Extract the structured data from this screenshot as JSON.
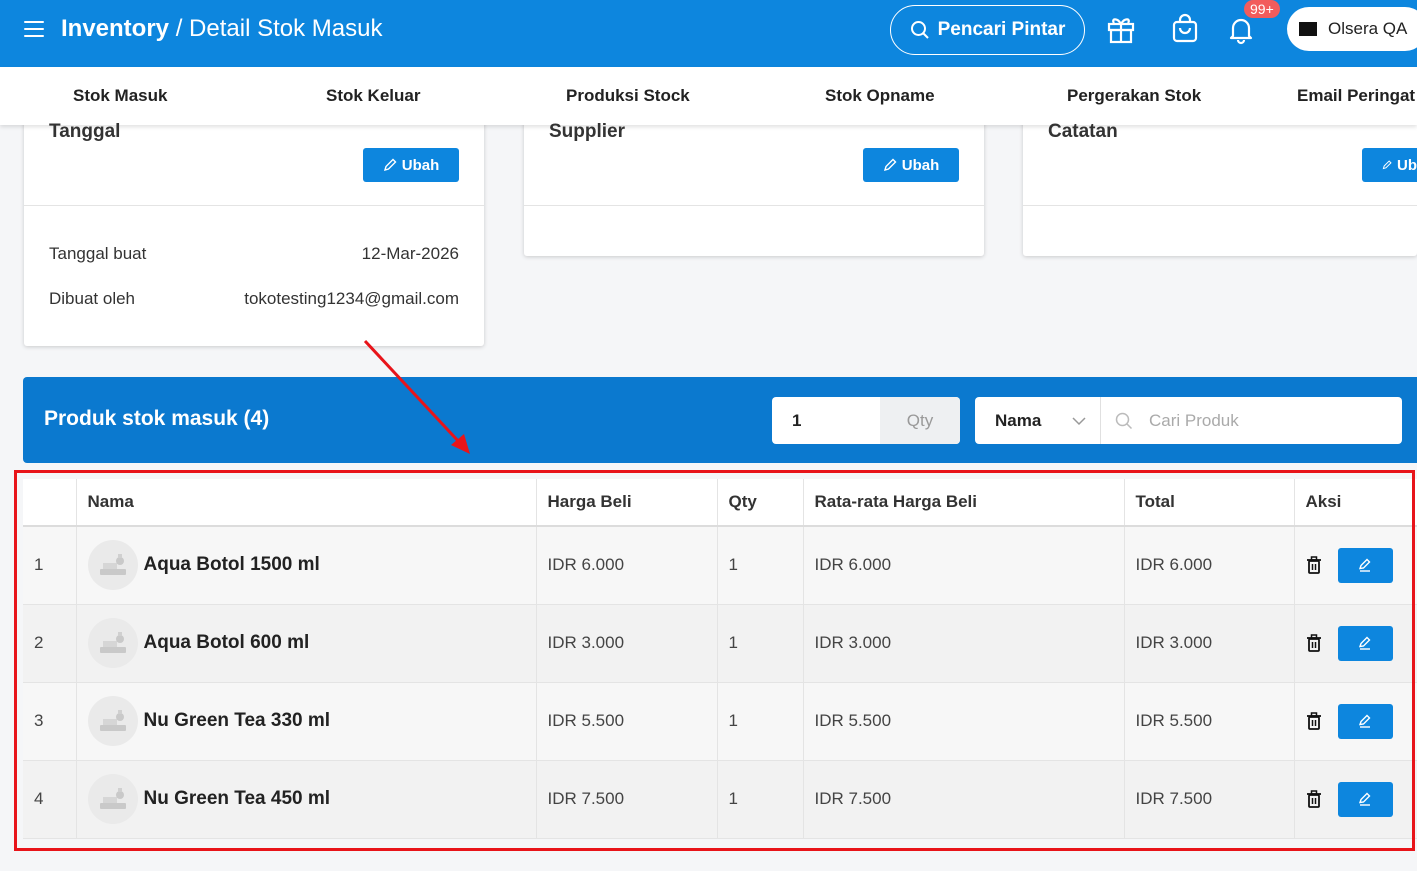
{
  "header": {
    "title_main": "Inventory",
    "title_sep": "/",
    "title_sub": "Detail Stok Masuk",
    "smart_search_label": "Pencari Pintar",
    "notification_badge": "99+",
    "account_name": "Olsera QA",
    "icons": [
      "menu-icon",
      "search-icon",
      "gift-icon",
      "shopping-bag-icon",
      "bell-icon"
    ]
  },
  "tabs": [
    "Stok Masuk",
    "Stok Keluar",
    "Produksi Stock",
    "Stok Opname",
    "Pergerakan Stok",
    "Email Peringat"
  ],
  "cards": {
    "tanggal": {
      "title": "Tanggal",
      "edit_label": "Ubah",
      "rows": [
        {
          "label": "Tanggal buat",
          "value": "12-Mar-2026"
        },
        {
          "label": "Dibuat oleh",
          "value": "tokotesting1234@gmail.com"
        }
      ]
    },
    "supplier": {
      "title": "Supplier",
      "edit_label": "Ubah"
    },
    "catatan": {
      "title": "Catatan",
      "edit_label": "Ub"
    }
  },
  "products": {
    "title": "Produk stok masuk (4)",
    "qty_value": "1",
    "qty_label": "Qty",
    "filter_selected": "Nama",
    "search_placeholder": "Cari Produk",
    "columns": [
      "",
      "Nama",
      "Harga Beli",
      "Qty",
      "Rata-rata Harga Beli",
      "Total",
      "Aksi"
    ],
    "rows": [
      {
        "no": "1",
        "name": "Aqua Botol 1500 ml",
        "price": "IDR 6.000",
        "qty": "1",
        "avg": "IDR 6.000",
        "total": "IDR 6.000"
      },
      {
        "no": "2",
        "name": "Aqua Botol 600 ml",
        "price": "IDR 3.000",
        "qty": "1",
        "avg": "IDR 3.000",
        "total": "IDR 3.000"
      },
      {
        "no": "3",
        "name": "Nu Green Tea 330 ml",
        "price": "IDR 5.500",
        "qty": "1",
        "avg": "IDR 5.500",
        "total": "IDR 5.500"
      },
      {
        "no": "4",
        "name": "Nu Green Tea 450 ml",
        "price": "IDR 7.500",
        "qty": "1",
        "avg": "IDR 7.500",
        "total": "IDR 7.500"
      }
    ]
  },
  "colors": {
    "primary": "#0d86de",
    "bar": "#0b79cf",
    "annotation": "#e8141a",
    "badge": "#f25c5c"
  }
}
